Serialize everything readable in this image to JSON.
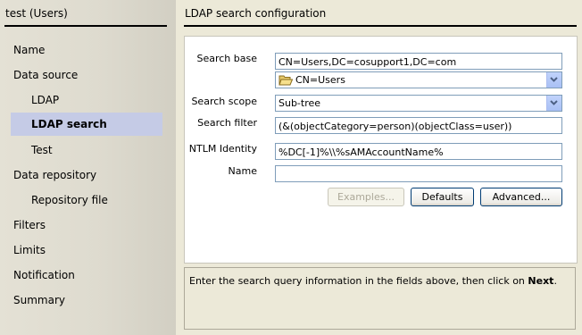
{
  "sidebar": {
    "title": "test (Users)",
    "items": [
      {
        "label": "Name"
      },
      {
        "label": "Data source"
      },
      {
        "label": "LDAP"
      },
      {
        "label": "LDAP search"
      },
      {
        "label": "Test"
      },
      {
        "label": "Data repository"
      },
      {
        "label": "Repository file"
      },
      {
        "label": "Filters"
      },
      {
        "label": "Limits"
      },
      {
        "label": "Notification"
      },
      {
        "label": "Summary"
      }
    ],
    "selected_index": 3,
    "selected_color": "#c5cbe6"
  },
  "panel": {
    "title": "LDAP search configuration"
  },
  "form": {
    "search_base_label": "Search base",
    "search_base_value": "CN=Users,DC=cosupport1,DC=com",
    "search_base_tree_value": "CN=Users",
    "search_scope_label": "Search scope",
    "search_scope_value": "Sub-tree",
    "search_filter_label": "Search filter",
    "search_filter_value": "(&(objectCategory=person)(objectClass=user))",
    "ntlm_label": "NTLM Identity",
    "ntlm_value": "%DC[-1]%\\\\%sAMAccountName%",
    "name_label": "Name",
    "name_value": ""
  },
  "buttons": {
    "examples": "Examples...",
    "defaults": "Defaults",
    "advanced": "Advanced..."
  },
  "hint": {
    "text_before": "Enter the search query information in the fields above, then click on ",
    "text_bold": "Next",
    "text_after": "."
  },
  "icons": {
    "folder": "folder-open-icon",
    "dropdown": "chevron-down-icon"
  }
}
